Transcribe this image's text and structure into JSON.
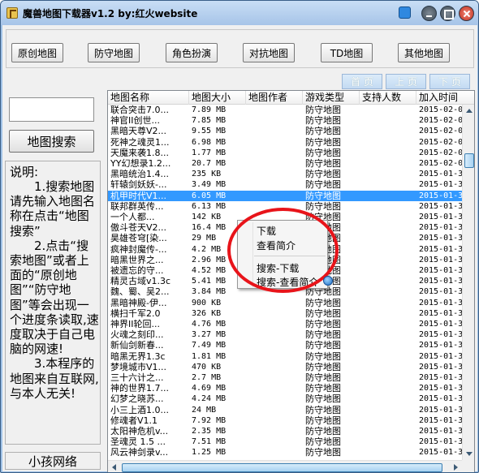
{
  "window": {
    "title": "魔兽地图下载器v1.2   by:红火website"
  },
  "categories": [
    "原创地图",
    "防守地图",
    "角色扮演",
    "对抗地图",
    "TD地图",
    "其他地图"
  ],
  "pager": {
    "first": "首 页",
    "prev": "上 页",
    "next": "下 页"
  },
  "search": {
    "value": "",
    "button": "地图搜索"
  },
  "description": {
    "title": "说明:",
    "body": "　　1.搜索地图请先输入地图名称在点击“地图搜索”\n　　2.点击“搜索地图”或者上面的“原创地图”“防守地图”等会出现一个进度条读取,速度取决于自己电脑的网速!\n　　3.本程序的地图来自互联网,与本人无关!"
  },
  "footer_label": "小孩网络",
  "listview": {
    "columns": [
      "地图名称",
      "地图大小",
      "地图作者",
      "游戏类型",
      "支持人数",
      "加入时间"
    ],
    "rows": [
      [
        "联合突击7.0...",
        "7.89 MB",
        "",
        "防守地图",
        "",
        "2015-02-0"
      ],
      [
        "神官II创世...",
        "7.85 MB",
        "",
        "防守地图",
        "",
        "2015-02-0"
      ],
      [
        "黑暗天尊V2...",
        "9.55 MB",
        "",
        "防守地图",
        "",
        "2015-02-0"
      ],
      [
        "死神之魂灵1...",
        "6.98 MB",
        "",
        "防守地图",
        "",
        "2015-02-0"
      ],
      [
        "天魔来袭1.8...",
        "1.77 MB",
        "",
        "防守地图",
        "",
        "2015-02-0"
      ],
      [
        "YY幻想录1.2...",
        "20.7 MB",
        "",
        "防守地图",
        "",
        "2015-02-0"
      ],
      [
        "黑暗统治1.4...",
        "235 KB",
        "",
        "防守地图",
        "",
        "2015-01-3"
      ],
      [
        "轩辕剑妖妖-...",
        "3.49 MB",
        "",
        "防守地图",
        "",
        "2015-01-3"
      ],
      [
        "机甲时代V1...",
        "6.05 MB",
        "",
        "防守地图",
        "",
        "2015-01-3"
      ],
      [
        "联邦群英传...",
        "6.13 MB",
        "",
        "防守地图",
        "",
        "2015-01-3"
      ],
      [
        "一个人都...",
        "142 KB",
        "",
        "防守地图",
        "",
        "2015-01-3"
      ],
      [
        "傲斗苍天V2...",
        "16.4 MB",
        "",
        "防守地图",
        "",
        "2015-01-3"
      ],
      [
        "昊雄苍穹[染...",
        "29 MB",
        "",
        "防守地图",
        "",
        "2015-01-3"
      ],
      [
        "疯神封魔传-...",
        "4.2 MB",
        "",
        "防守地图",
        "",
        "2015-01-3"
      ],
      [
        "暗黑世界之...",
        "2.96 MB",
        "",
        "防守地图",
        "",
        "2015-01-3"
      ],
      [
        "被遗忘的守...",
        "4.52 MB",
        "",
        "防守地图",
        "",
        "2015-01-3"
      ],
      [
        "精灵古域v1.3c",
        "5.41 MB",
        "",
        "防守地图",
        "",
        "2015-01-3"
      ],
      [
        "魏、蜀、吴2...",
        "3.84 MB",
        "",
        "防守地图",
        "",
        "2015-01-3"
      ],
      [
        "黑暗神殿-伊...",
        "900 KB",
        "",
        "防守地图",
        "",
        "2015-01-3"
      ],
      [
        "横扫千军2.0",
        "326 KB",
        "",
        "防守地图",
        "",
        "2015-01-3"
      ],
      [
        "神界II轮回...",
        "4.76 MB",
        "",
        "防守地图",
        "",
        "2015-01-3"
      ],
      [
        "火魂之刻印...",
        "3.27 MB",
        "",
        "防守地图",
        "",
        "2015-01-3"
      ],
      [
        "新仙剑新春...",
        "7.49 MB",
        "",
        "防守地图",
        "",
        "2015-01-3"
      ],
      [
        "暗黑无界1.3c",
        "1.81 MB",
        "",
        "防守地图",
        "",
        "2015-01-3"
      ],
      [
        "梦境城市V1...",
        "470 KB",
        "",
        "防守地图",
        "",
        "2015-01-3"
      ],
      [
        "三十六计之...",
        "2.7 MB",
        "",
        "防守地图",
        "",
        "2015-01-3"
      ],
      [
        "神的世界1.7...",
        "4.69 MB",
        "",
        "防守地图",
        "",
        "2015-01-3"
      ],
      [
        "幻梦之晓苏...",
        "4.24 MB",
        "",
        "防守地图",
        "",
        "2015-01-3"
      ],
      [
        "小三上酒1.0...",
        "24 MB",
        "",
        "防守地图",
        "",
        "2015-01-3"
      ],
      [
        "修魂者V1.1",
        "7.92 MB",
        "",
        "防守地图",
        "",
        "2015-01-3"
      ],
      [
        "太阳神危机v...",
        "2.35 MB",
        "",
        "防守地图",
        "",
        "2015-01-3"
      ],
      [
        "圣魂灵 1.5 ...",
        "7.51 MB",
        "",
        "防守地图",
        "",
        "2015-01-3"
      ],
      [
        "风云神剑录v...",
        "1.25 MB",
        "",
        "防守地图",
        "",
        "2015-01-3"
      ]
    ],
    "selected_row": 8
  },
  "context_menu": {
    "items": [
      "下载",
      "查看简介",
      "搜索-下载",
      "搜索-查看简介"
    ]
  },
  "colors": {
    "selection": "#3399ff",
    "highlight_ring": "#e8141a",
    "window_frame": "#9fc1e6"
  }
}
